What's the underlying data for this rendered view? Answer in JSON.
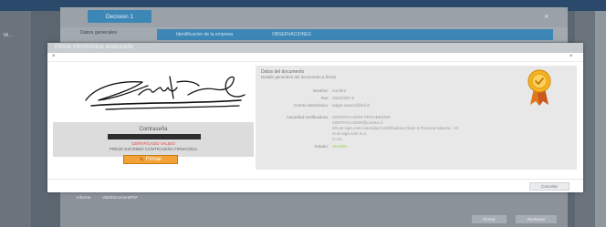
{
  "background": {
    "decision_tab": "Decision 1",
    "tabs": {
      "datos_generales": "Datos generales",
      "blurred_tab_1": "Identificacion de la empresa",
      "blurred_tab_2": "OBSERVACIONES"
    },
    "footer_label": "Informe",
    "footer_value": "ValidDocumentPDF",
    "button_1": "Firmar",
    "button_2": "Rechazar",
    "left_text": "Mi…",
    "header_close": "×"
  },
  "modal": {
    "title": "Firma electrónica avanzada",
    "close_left": "×",
    "close_right": "×",
    "signature_panel": {
      "password_label": "Contraseña",
      "certificate_status": "CERTIFICADO VALIDO",
      "certificate_hint": "PRESE ESCRIBIR CONTRASEÑA FIRMA/2011",
      "sign_button": "Firmar"
    },
    "document": {
      "heading": "Datos del documento",
      "subheading": "Detalle generales del documento a firmar",
      "fields": [
        {
          "label": "Nombre:",
          "value": "nombre"
        },
        {
          "label": "Rut:",
          "value": "10022297-K"
        },
        {
          "label": "Correo electrónico:",
          "value": "edgar.suarez@bnf.cl"
        },
        {
          "label": "Autoridad certificadora:",
          "value": "CERTIFICADOR PROVEEDOR"
        },
        {
          "label": "",
          "value": "CERTIFICADOR@correo.cl"
        },
        {
          "label": "",
          "value": "CN=E-sign.com Autoridad Certificadora Clase 3 Persona Natural - V2"
        },
        {
          "label": "",
          "value": "O=E-sign.com S.A."
        },
        {
          "label": "",
          "value": "C=CL"
        },
        {
          "label": "Estado:",
          "value": "VALIDO"
        }
      ]
    },
    "cancel_button": "Cancelar"
  },
  "colors": {
    "accent_blue": "#3d87b7",
    "valid_green": "#8ccf4a",
    "warning_red": "#e3413a",
    "sign_orange": "#f2a236"
  },
  "icons": {
    "medal": "certificate-medal-icon",
    "pen": "pen-icon"
  }
}
